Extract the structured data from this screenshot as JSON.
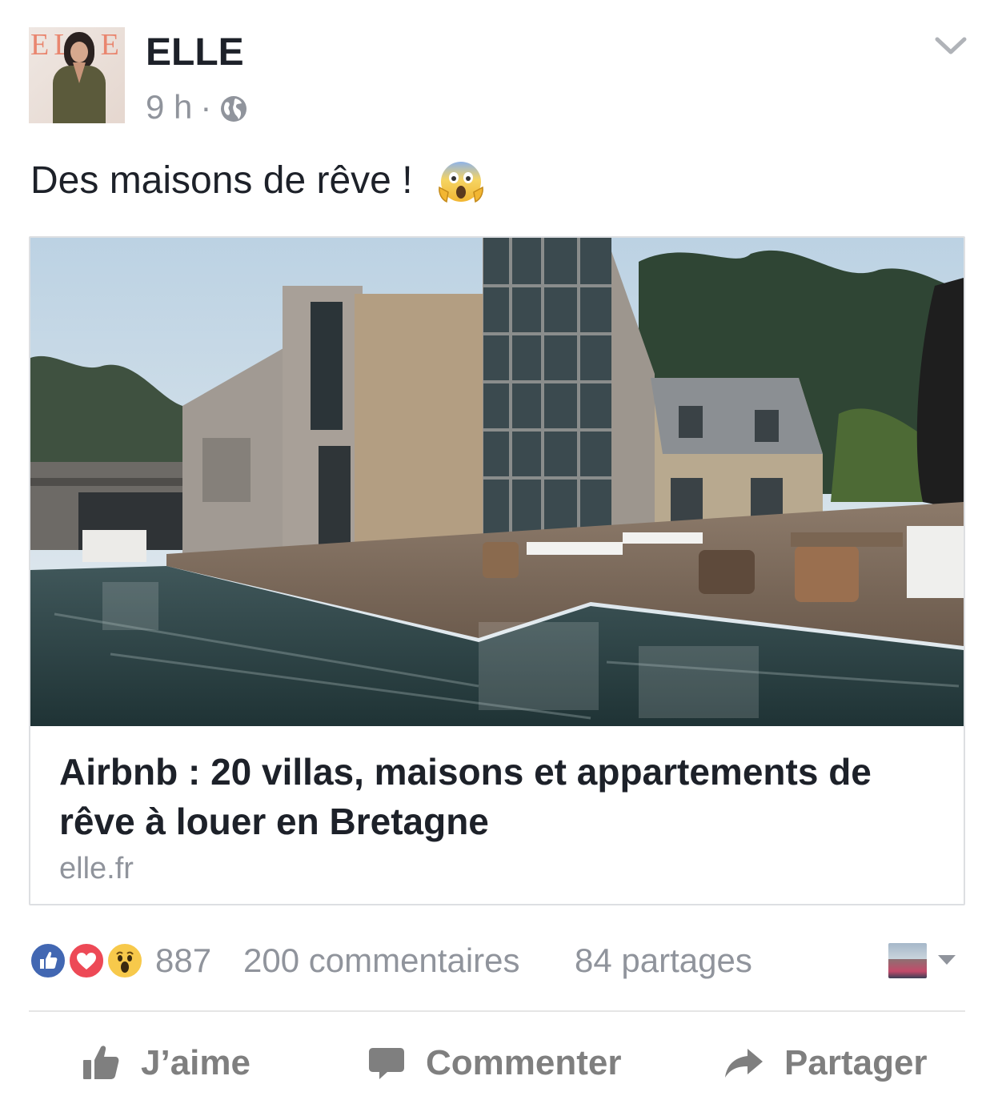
{
  "post": {
    "author": "ELLE",
    "avatar_logo_text": "ELLE",
    "time": "9 h",
    "separator": "·",
    "privacy_icon": "globe-icon",
    "menu_icon": "chevron-down-icon",
    "text": "Des maisons de rêve !",
    "emoji": "face-screaming-in-fear-emoji"
  },
  "link": {
    "title": "Airbnb : 20 villas, maisons et appartements de rêve à louer en Bretagne",
    "domain": "elle.fr"
  },
  "stats": {
    "reaction_icons": [
      "like-reaction-icon",
      "love-reaction-icon",
      "wow-reaction-icon"
    ],
    "reactions": "887",
    "comments": "200 commentaires",
    "shares": "84 partages"
  },
  "actions": {
    "like_label": "J’aime",
    "comment_label": "Commenter",
    "share_label": "Partager"
  },
  "colors": {
    "text": "#1d2129",
    "muted": "#90949c",
    "action": "#7f7f7f",
    "like_blue": "#4267b2",
    "love_red": "#ed4956",
    "wow_yellow": "#f7c94b",
    "border": "#dddfe2"
  }
}
